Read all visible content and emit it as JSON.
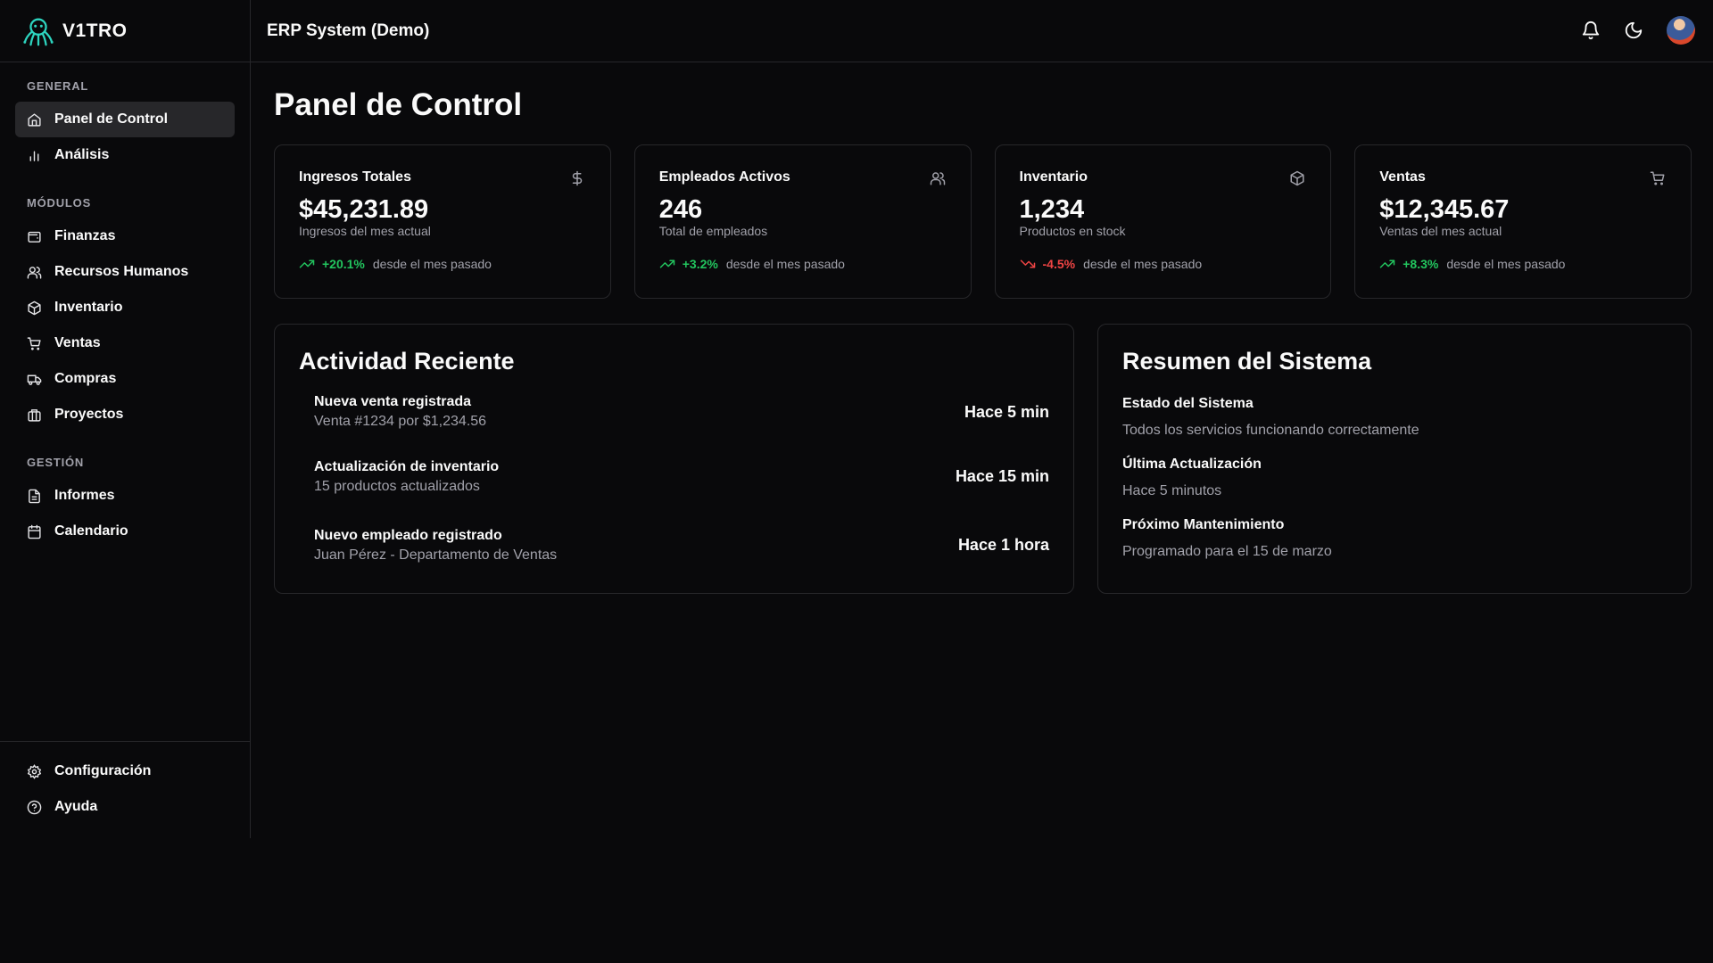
{
  "brand": {
    "name": "V1TRO"
  },
  "header": {
    "title": "ERP System (Demo)"
  },
  "sidebar": {
    "sections": [
      {
        "heading": "GENERAL",
        "items": [
          {
            "label": "Panel de Control",
            "icon": "home-icon",
            "active": true
          },
          {
            "label": "Análisis",
            "icon": "bar-chart-icon"
          }
        ]
      },
      {
        "heading": "MÓDULOS",
        "items": [
          {
            "label": "Finanzas",
            "icon": "wallet-icon"
          },
          {
            "label": "Recursos Humanos",
            "icon": "users-icon"
          },
          {
            "label": "Inventario",
            "icon": "package-icon"
          },
          {
            "label": "Ventas",
            "icon": "cart-icon"
          },
          {
            "label": "Compras",
            "icon": "truck-icon"
          },
          {
            "label": "Proyectos",
            "icon": "briefcase-icon"
          }
        ]
      },
      {
        "heading": "GESTIÓN",
        "items": [
          {
            "label": "Informes",
            "icon": "file-text-icon"
          },
          {
            "label": "Calendario",
            "icon": "calendar-icon"
          }
        ]
      }
    ],
    "bottom": [
      {
        "label": "Configuración",
        "icon": "gear-icon"
      },
      {
        "label": "Ayuda",
        "icon": "help-circle-icon"
      }
    ]
  },
  "main": {
    "title": "Panel de Control",
    "stats": [
      {
        "title": "Ingresos Totales",
        "icon": "dollar-icon",
        "value": "$45,231.89",
        "sub": "Ingresos del mes actual",
        "trend": "+20.1%",
        "trend_dir": "up",
        "trend_text": "desde el mes pasado"
      },
      {
        "title": "Empleados Activos",
        "icon": "users-icon",
        "value": "246",
        "sub": "Total de empleados",
        "trend": "+3.2%",
        "trend_dir": "up",
        "trend_text": "desde el mes pasado"
      },
      {
        "title": "Inventario",
        "icon": "package-icon",
        "value": "1,234",
        "sub": "Productos en stock",
        "trend": "-4.5%",
        "trend_dir": "down",
        "trend_text": "desde el mes pasado"
      },
      {
        "title": "Ventas",
        "icon": "cart-icon",
        "value": "$12,345.67",
        "sub": "Ventas del mes actual",
        "trend": "+8.3%",
        "trend_dir": "up",
        "trend_text": "desde el mes pasado"
      }
    ],
    "activity": {
      "title": "Actividad Reciente",
      "items": [
        {
          "title": "Nueva venta registrada",
          "desc": "Venta #1234 por $1,234.56",
          "time": "Hace 5 min"
        },
        {
          "title": "Actualización de inventario",
          "desc": "15 productos actualizados",
          "time": "Hace 15 min"
        },
        {
          "title": "Nuevo empleado registrado",
          "desc": "Juan Pérez - Departamento de Ventas",
          "time": "Hace 1 hora"
        }
      ]
    },
    "summary": {
      "title": "Resumen del Sistema",
      "items": [
        {
          "label": "Estado del Sistema",
          "value": "Todos los servicios funcionando correctamente"
        },
        {
          "label": "Última Actualización",
          "value": "Hace 5 minutos"
        },
        {
          "label": "Próximo Mantenimiento",
          "value": "Programado para el 15 de marzo"
        }
      ]
    }
  },
  "colors": {
    "background": "#09090b",
    "border": "#27272a",
    "muted": "#a1a1aa",
    "positive": "#22c55e",
    "negative": "#ef4444",
    "active_item": "#27272a"
  }
}
